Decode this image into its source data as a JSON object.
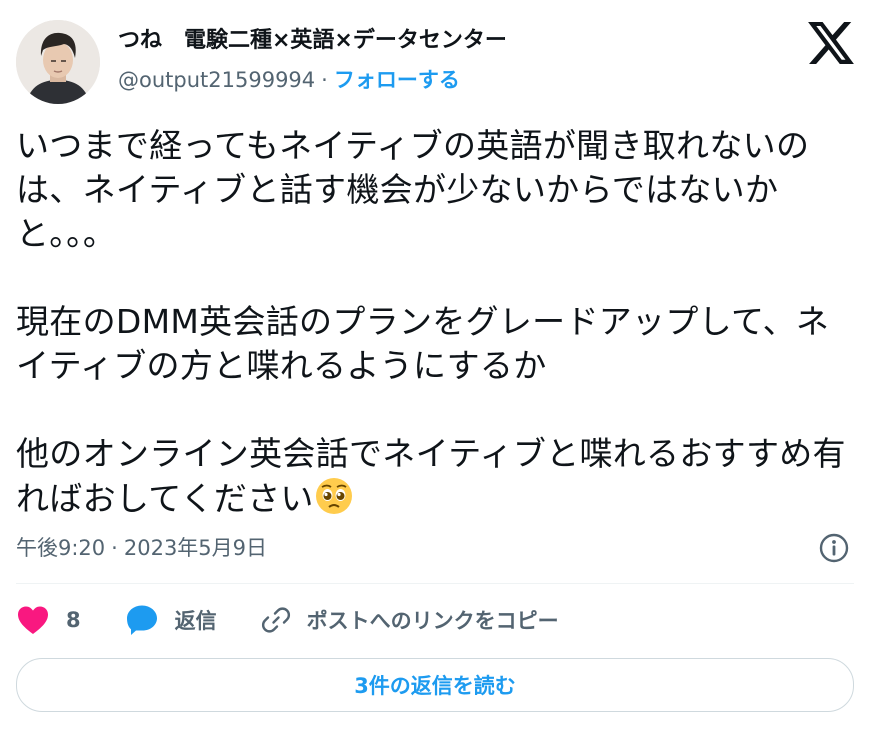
{
  "author": {
    "display_name": "つね　電験二種×英語×データセンター",
    "handle": "@output21599994",
    "follow_label": "フォローする"
  },
  "tweet": {
    "text": "いつまで経ってもネイティブの英語が聞き取れないのは、ネイティブと話す機会が少ないからではないかと。。。\n\n現在のDMM英会話のプランをグレードアップして、ネイティブの方と喋れるようにするか\n\n他のオンライン英会話でネイティブと喋れるおすすめ有ればおしてください",
    "emoji": "pleading-face-emoji"
  },
  "meta": {
    "time": "午後9:20",
    "separator": "·",
    "date": "2023年5月9日"
  },
  "actions": {
    "like_count": "8",
    "reply_label": "返信",
    "copy_link_label": "ポストへのリンクをコピー"
  },
  "read_replies_label": "3件の返信を読む",
  "colors": {
    "accent": "#1d9bf0",
    "like": "#f91880",
    "text": "#0f1419",
    "secondary": "#536471"
  }
}
